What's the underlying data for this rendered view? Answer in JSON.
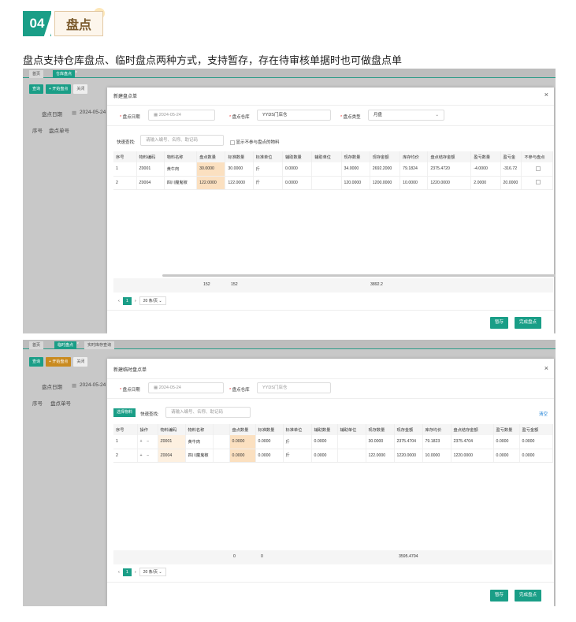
{
  "section": {
    "number": "04",
    "title": "盘点",
    "description": "盘点支持仓库盘点、临时盘点两种方式，支持暂存，存在待审核单据时也可做盘点单"
  },
  "shot1": {
    "tabs": [
      "首页",
      "仓库盘点"
    ],
    "toolbar": [
      "查询",
      "+ 开始盘点",
      "关闭"
    ],
    "bg_date_label": "盘点日期",
    "bg_date_value": "2024-05-24",
    "bg_col1": "序号",
    "bg_col2": "盘点单号",
    "modal": {
      "title": "新建盘点单",
      "date_label": "盘点日期",
      "date_value": "2024-05-24",
      "warehouse_label": "盘点仓库",
      "warehouse_value": "YYDS门店仓",
      "type_label": "盘点类型",
      "type_value": "月盘",
      "search_label": "快速查找:",
      "search_placeholder": "请输入编号、名称、助记码",
      "checkbox_label": "显示不参与盘点的物料",
      "columns": [
        "序号",
        "物料编码",
        "物料名称",
        "盘点数量",
        "标准数量",
        "标准单位",
        "辅助数量",
        "辅助单位",
        "现存数量",
        "现存金额",
        "库存均价",
        "盘点结存金额",
        "盈亏数量",
        "盈亏金",
        "不参与盘点"
      ],
      "rows": [
        [
          "1",
          "Z0001",
          "黄牛肉",
          "30.0000",
          "30.0000",
          "斤",
          "0.0000",
          "",
          "34.0000",
          "2692.2000",
          "79.1824",
          "2375.4720",
          "-4.0000",
          "-316.72",
          ""
        ],
        [
          "2",
          "Z0004",
          "四川魔鬼椒",
          "122.0000",
          "122.0000",
          "斤",
          "0.0000",
          "",
          "120.0000",
          "1200.0000",
          "10.0000",
          "1220.0000",
          "2.0000",
          "20.0000",
          ""
        ]
      ],
      "totals": {
        "count": "152",
        "std": "152",
        "amount": "3892.2"
      },
      "page": "1",
      "page_size": "20 条/页",
      "save_button": "暂存",
      "finish_button": "完成盘点"
    }
  },
  "shot2": {
    "tabs": [
      "首页",
      "临时盘点",
      "实时库存查询"
    ],
    "toolbar": [
      "查询",
      "+ 开始盘点",
      "关闭"
    ],
    "bg_date_label": "盘点日期",
    "bg_date_value": "2024-05-24",
    "bg_col1": "序号",
    "bg_col2": "盘点单号",
    "modal": {
      "title": "新建临时盘点单",
      "date_label": "盘点日期",
      "date_value": "2024-05-24",
      "warehouse_label": "盘点仓库",
      "warehouse_value": "YYDS门店仓",
      "select_button": "选择物料",
      "search_label": "快速查找:",
      "search_placeholder": "请输入编号、名称、助记码",
      "clear_link": "清空",
      "columns": [
        "序号",
        "操作",
        "物料编码",
        "物料名称",
        "",
        "盘点数量",
        "标准数量",
        "标准单位",
        "辅助数量",
        "辅助单位",
        "现存数量",
        "现存金额",
        "库存均价",
        "盘点结存金额",
        "盈亏数量",
        "盈亏金额"
      ],
      "rows": [
        [
          "1",
          "+ −",
          "Z0001",
          "黄牛肉",
          "",
          "0.0000",
          "0.0000",
          "斤",
          "0.0000",
          "",
          "30.0000",
          "2375.4704",
          "79.1823",
          "2375.4704",
          "0.0000",
          "0.0000"
        ],
        [
          "2",
          "+ −",
          "Z0004",
          "四川魔鬼椒",
          "",
          "0.0000",
          "0.0000",
          "斤",
          "0.0000",
          "",
          "122.0000",
          "1220.0000",
          "10.0000",
          "1220.0000",
          "0.0000",
          "0.0000"
        ]
      ],
      "totals": {
        "count": "0",
        "std": "0",
        "amount": "3595.4704"
      },
      "page": "1",
      "page_size": "20 条/页",
      "save_button": "暂存",
      "finish_button": "完成盘点"
    }
  }
}
